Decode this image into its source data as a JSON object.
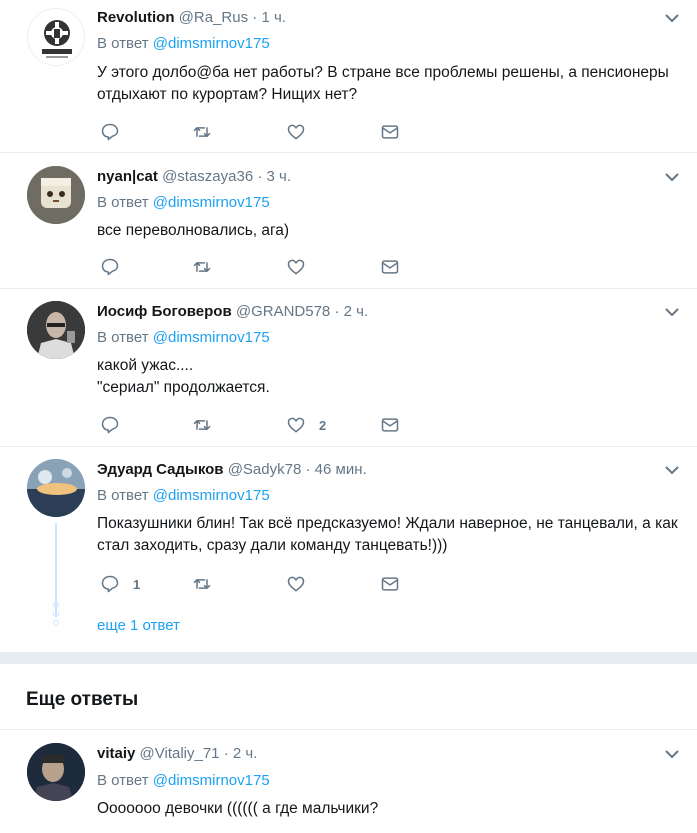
{
  "tweets": [
    {
      "name": "Revolution",
      "handle": "@Ra_Rus",
      "time": "1 ч.",
      "reply_prefix": "В ответ",
      "reply_to": "@dimsmirnov175",
      "text": "У этого долбо@ба нет работы? В стране все проблемы решены, а пенсионеры отдыхают по курортам? Нищих нет?",
      "reply_count": "",
      "like_count": ""
    },
    {
      "name": "nyan|cat",
      "handle": "@staszaya36",
      "time": "3 ч.",
      "reply_prefix": "В ответ",
      "reply_to": "@dimsmirnov175",
      "text": "все переволновались, ага)",
      "reply_count": "",
      "like_count": ""
    },
    {
      "name": "Иосиф Боговеров",
      "handle": "@GRAND578",
      "time": "2 ч.",
      "reply_prefix": "В ответ",
      "reply_to": "@dimsmirnov175",
      "text": "какой ужас....\n\"сериал\" продолжается.",
      "reply_count": "",
      "like_count": "2"
    },
    {
      "name": "Эдуард Садыков",
      "handle": "@Sadyk78",
      "time": "46 мин.",
      "reply_prefix": "В ответ",
      "reply_to": "@dimsmirnov175",
      "text": "Показушники блин! Так всё предсказуемо! Ждали наверное, не танцевали, а как стал заходить, сразу дали команду танцевать!)))",
      "reply_count": "1",
      "like_count": ""
    },
    {
      "name": "vitaiy",
      "handle": "@Vitaliy_71",
      "time": "2 ч.",
      "reply_prefix": "В ответ",
      "reply_to": "@dimsmirnov175",
      "text": "Ооооооо девочки (((((( а где мальчики?",
      "reply_count": "",
      "like_count": ""
    }
  ],
  "thread": {
    "more_replies": "еще 1 ответ"
  },
  "section": {
    "title": "Еще ответы"
  },
  "colors": {
    "accent": "#1da1f2",
    "muted": "#657786",
    "divider": "#e6ecf0",
    "thread": "#cce6ff"
  }
}
